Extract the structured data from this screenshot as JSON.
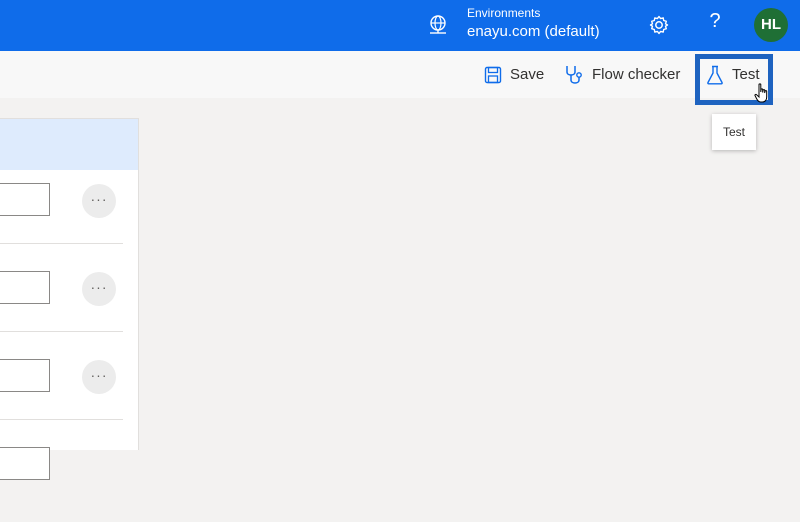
{
  "header": {
    "environment_label": "Environments",
    "environment_value": "enayu.com (default)",
    "help_glyph": "?",
    "avatar_initials": "HL",
    "brand_color": "#0f6cea",
    "avatar_color": "#1f6f35"
  },
  "commandbar": {
    "save_label": "Save",
    "flow_checker_label": "Flow checker",
    "test_label": "Test",
    "tooltip_text": "Test",
    "highlight_color": "#1e63c0"
  },
  "panel": {
    "rows": [
      {
        "more_label": "···"
      },
      {
        "more_label": "···"
      },
      {
        "more_label": "···"
      },
      {
        "more_label": "···"
      }
    ]
  },
  "icons": [
    "environment-globe-icon",
    "gear-icon",
    "help-icon",
    "save-icon",
    "stethoscope-icon",
    "flask-icon",
    "hand-cursor-icon"
  ]
}
